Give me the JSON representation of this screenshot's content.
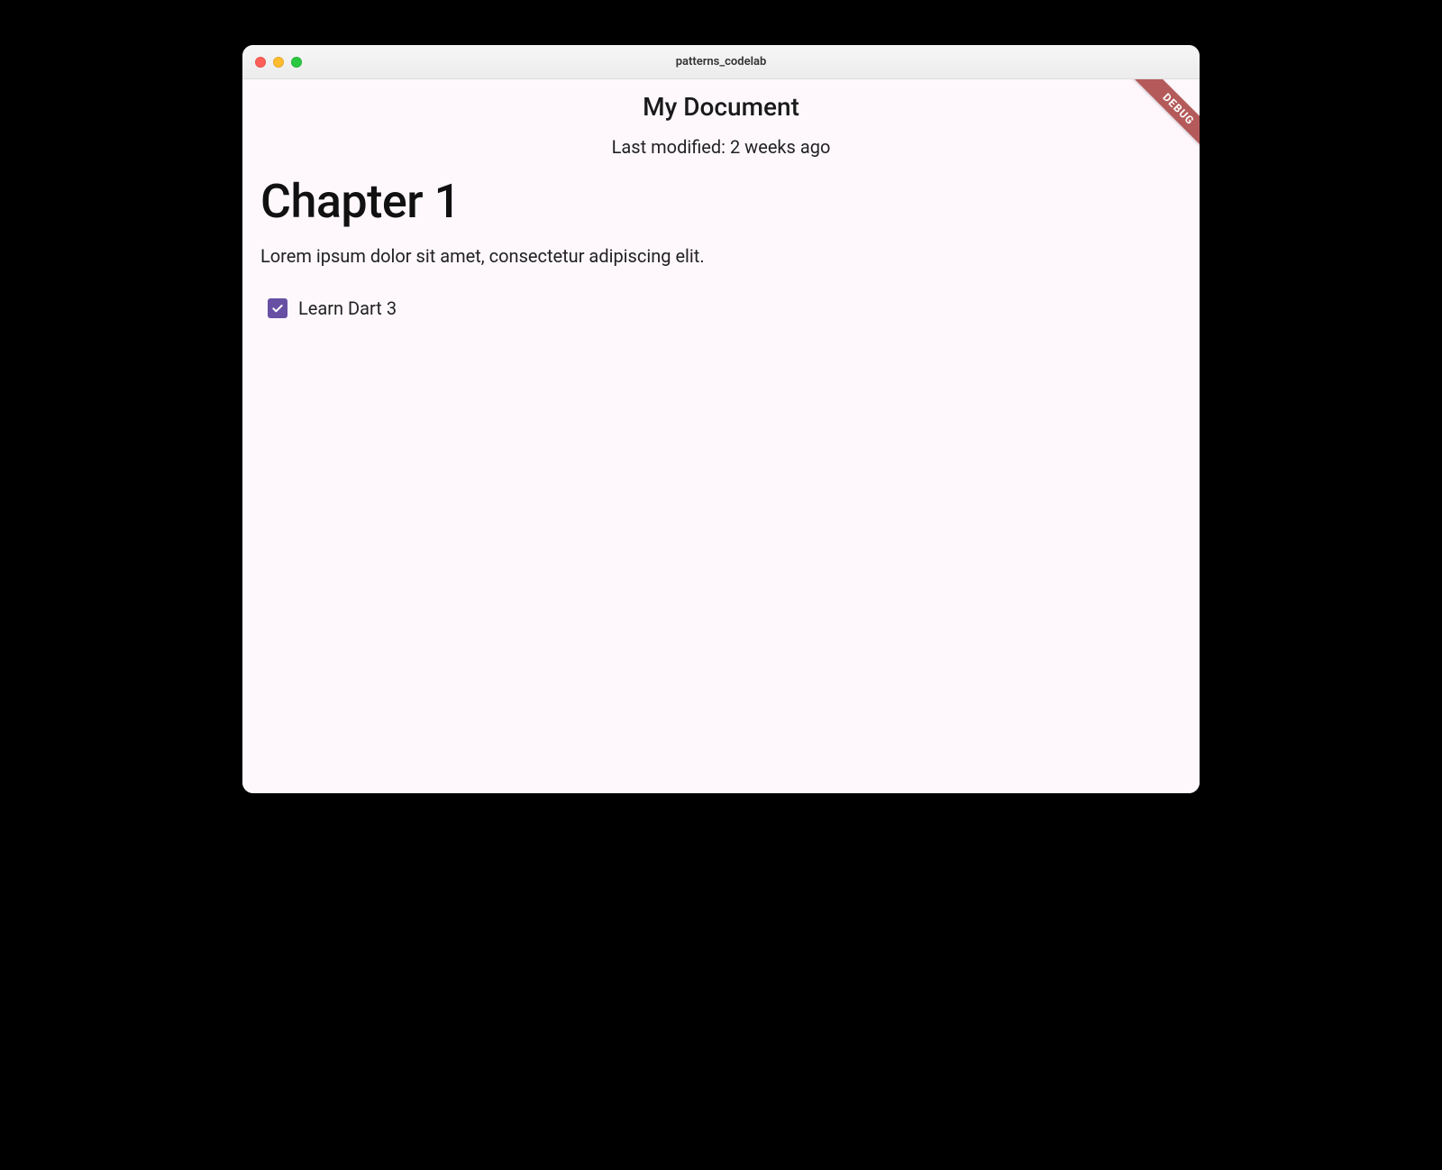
{
  "window": {
    "title": "patterns_codelab"
  },
  "appbar": {
    "title": "My Document"
  },
  "subtitle": "Last modified: 2 weeks ago",
  "content": {
    "heading": "Chapter 1",
    "paragraph": "Lorem ipsum dolor sit amet, consectetur adipiscing elit.",
    "checkbox": {
      "label": "Learn Dart 3",
      "checked": true
    }
  },
  "debug_banner": "DEBUG",
  "colors": {
    "surface": "#fef8fd",
    "checkbox_fill": "#6750a4",
    "debug_banner": "#b45a5a"
  }
}
